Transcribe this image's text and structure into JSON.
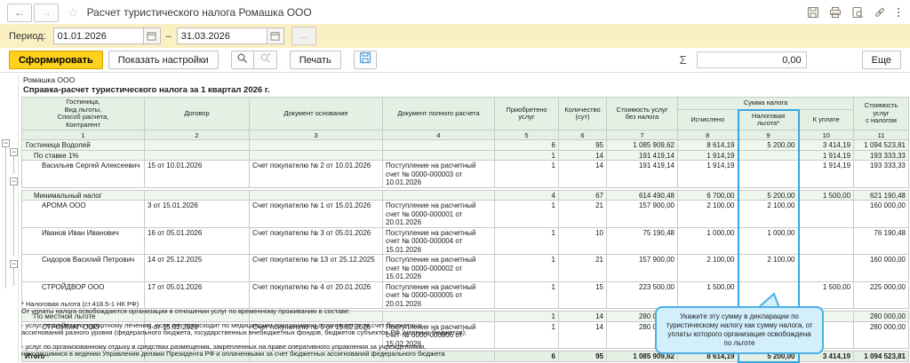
{
  "window": {
    "title": "Расчет туристического налога Ромашка ООО",
    "back": "←",
    "forward": "→",
    "star": "☆"
  },
  "period": {
    "label": "Период:",
    "from": "01.01.2026",
    "dash": "–",
    "to": "31.03.2026",
    "more": "..."
  },
  "toolbar": {
    "generate": "Сформировать",
    "settings": "Показать настройки",
    "print": "Печать",
    "sum_symbol": "Σ",
    "sum_value": "0,00",
    "more": "Еще"
  },
  "report": {
    "company": "Ромашка ООО",
    "title": "Справка-расчет туристического налога за 1 квартал 2026 г.",
    "expander": "−",
    "columns": {
      "c1": "Гостиница,\nВид льготы,\nСпособ расчета,\nКонтрагент",
      "c2": "Договор",
      "c3": "Документ основание",
      "c4": "Документ полного расчета",
      "c5": "Приобретено\nуслуг",
      "c6": "Количество\n(сут)",
      "c7": "Стоимость услуг\nбез налога",
      "tax_group": "Сумма налога",
      "c8": "Исчислено",
      "c9": "Налоговая\nльгота*",
      "c10": "К уплате",
      "c11": "Стоимость услуг\nс налогом"
    },
    "numbers": [
      "1",
      "2",
      "3",
      "4",
      "5",
      "6",
      "7",
      "8",
      "9",
      "10",
      "11"
    ],
    "rows": [
      {
        "type": "group1",
        "level": 1,
        "cells": [
          "Гостиница Водолей",
          "",
          "",
          "",
          "6",
          "95",
          "1 085 909,62",
          "8 614,19",
          "5 200,00",
          "3 414,19",
          "1 094 523,81"
        ]
      },
      {
        "type": "group2",
        "level": 2,
        "cells": [
          "По ставке 1%",
          "",
          "",
          "",
          "1",
          "14",
          "191 419,14",
          "1 914,19",
          "",
          "1 914,19",
          "193 333,33"
        ]
      },
      {
        "type": "item",
        "level": 3,
        "cells": [
          "Васильев Сергей Алексеевич",
          "15 от 10.01.2026",
          "Счет покупателю № 2 от 10.01.2026",
          "Поступление на расчетный счет № 0000-000003 от 10.01.2026",
          "1",
          "14",
          "191 419,14",
          "1 914,19",
          "",
          "1 914,19",
          "193 333,33"
        ]
      },
      {
        "type": "spacer",
        "level": 0,
        "cells": [
          "",
          "",
          "",
          "",
          "",
          "",
          "",
          "",
          "",
          "",
          ""
        ]
      },
      {
        "type": "group2",
        "level": 2,
        "cells": [
          "Минимальный налог",
          "",
          "",
          "",
          "4",
          "67",
          "614 490,48",
          "6 700,00",
          "5 200,00",
          "1 500,00",
          "621 190,48"
        ]
      },
      {
        "type": "item",
        "level": 3,
        "cells": [
          "АРОМА ООО",
          "3 от 15.01.2026",
          "Счет покупателю № 1 от 15.01.2026",
          "Поступление на расчетный счет № 0000-000001 от 20.01.2026",
          "1",
          "21",
          "157 900,00",
          "2 100,00",
          "2 100,00",
          "",
          "160 000,00"
        ]
      },
      {
        "type": "item",
        "level": 3,
        "cells": [
          "Иванов Иван Иванович",
          "16 от 05.01.2026",
          "Счет покупателю № 3 от 05.01.2026",
          "Поступление на расчетный счет № 0000-000004 от 15.01.2026",
          "1",
          "10",
          "75 190,48",
          "1 000,00",
          "1 000,00",
          "",
          "76 190,48"
        ]
      },
      {
        "type": "item",
        "level": 3,
        "cells": [
          "Сидоров Василий Петрович",
          "14 от 25.12.2025",
          "Счет покупателю № 13 от 25.12.2025",
          "Поступление на расчетный счет № 0000-000002 от 15.01.2026",
          "1",
          "21",
          "157 900,00",
          "2 100,00",
          "2 100,00",
          "",
          "160 000,00"
        ]
      },
      {
        "type": "item",
        "level": 3,
        "cells": [
          "СТРОЙДВОР ООО",
          "17 от 05.01.2026",
          "Счет покупателю № 4 от 20.01.2026",
          "Поступление на расчетный счет № 0000-000005 от 20.01.2026",
          "1",
          "15",
          "223 500,00",
          "1 500,00",
          "",
          "1 500,00",
          "225 000,00"
        ]
      },
      {
        "type": "spacer",
        "level": 0,
        "cells": [
          "",
          "",
          "",
          "",
          "",
          "",
          "",
          "",
          "",
          "",
          ""
        ]
      },
      {
        "type": "group2",
        "level": 2,
        "cells": [
          "По местной льготе",
          "",
          "",
          "",
          "1",
          "14",
          "280 000,00",
          "",
          "",
          "",
          "280 000,00"
        ]
      },
      {
        "type": "item",
        "level": 3,
        "cells": [
          "СТРОЙМАГ ООО",
          "5 от 15.02.2026",
          "Счет покупателю № 5 от 15.02.2026",
          "Поступление на расчетный счет № 0000-000006 от 15.02.2026",
          "1",
          "14",
          "280 000,00",
          "",
          "",
          "",
          "280 000,00"
        ]
      },
      {
        "type": "spacer",
        "level": 0,
        "cells": [
          "",
          "",
          "",
          "",
          "",
          "",
          "",
          "",
          "",
          "",
          ""
        ]
      },
      {
        "type": "total",
        "level": 0,
        "cells": [
          "Итого",
          "",
          "",
          "",
          "6",
          "95",
          "1 085 909,62",
          "8 614,19",
          "5 200,00",
          "3 414,19",
          "1 094 523,81"
        ]
      }
    ],
    "footnote": "* Налоговая льгота (ст.418.5-1 НК РФ)\nОт уплаты налога освобождаются организации в отношении услуг по временному проживанию в составе:\n\n- услуг по санаторно-курортному лечению, если оно происходит по медицинским показаниям и оплачивается за счет бюджетных\nассигнований разного уровня (федерального бюджета, государственных внебюджетных фондов, бюджетов субъектов РФ, местных бюджетов);\n\n- услуг по организованному отдыху в средствах размещения, закрепленных на праве оперативного управления за учреждениями,\nнаходящимися в ведении Управления делами Президента РФ и оплаченными за счет бюджетных ассигнований федерального бюджета"
  },
  "callout": {
    "text": "Укажите эту сумму в декларации по туристическому налогу как сумму налога, от уплаты которого организация освобождена по льготе"
  },
  "colors": {
    "highlight_blue": "#35a7e0",
    "callout_fill": "#d3effc",
    "header_green": "#e4f0e4",
    "group_green": "#eef6ee",
    "period_yellow": "#fbf0c4",
    "generate_yellow": "#ffd11c"
  }
}
